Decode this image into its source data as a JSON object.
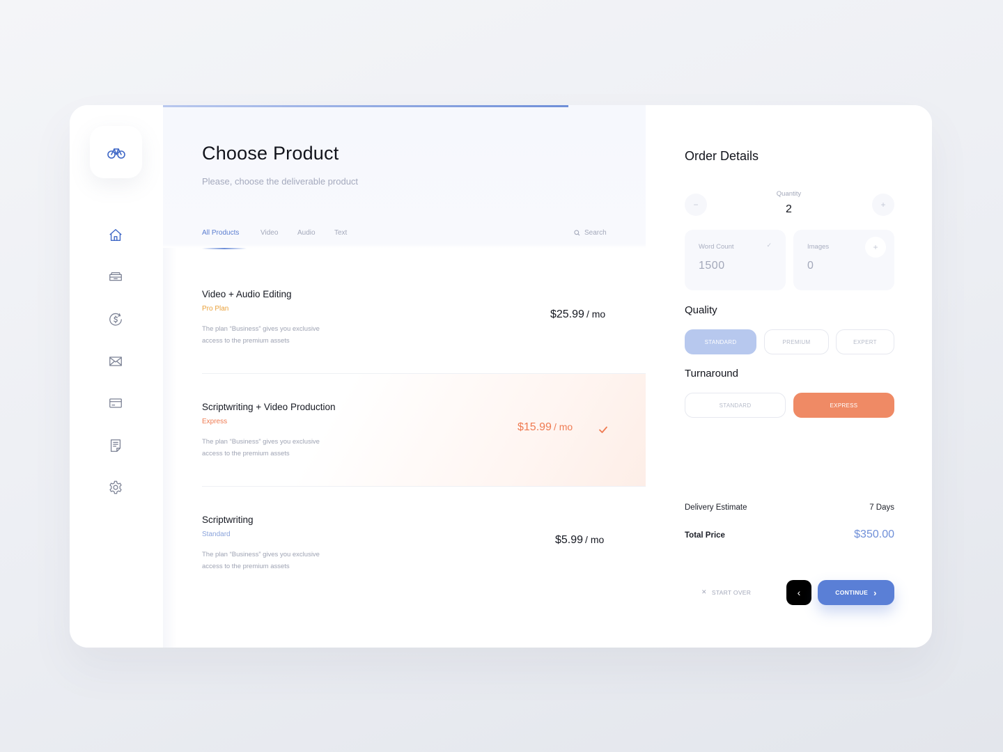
{
  "colors": {
    "accent_blue": "#5a7fd6",
    "accent_orange": "#ef8a65",
    "pro_plan": "#e9a13b",
    "express": "#ef7b52",
    "standard": "#8aa3db"
  },
  "sidebar": {
    "logo_icon": "bike-icon",
    "items": [
      {
        "icon": "home-icon"
      },
      {
        "icon": "archive-icon"
      },
      {
        "icon": "dollar-icon"
      },
      {
        "icon": "mail-icon"
      },
      {
        "icon": "credit-card-icon"
      },
      {
        "icon": "document-icon"
      },
      {
        "icon": "gear-icon"
      }
    ]
  },
  "main": {
    "progress": 0.84,
    "title": "Choose Product",
    "subtitle": "Please, choose the deliverable product",
    "tabs": [
      {
        "label": "All Products",
        "active": true
      },
      {
        "label": "Video"
      },
      {
        "label": "Audio"
      },
      {
        "label": "Text"
      }
    ],
    "search_label": "Search",
    "products": [
      {
        "name": "Video + Audio Editing",
        "plan": "Pro Plan",
        "desc_line1": "The plan “Business” gives you exclusive",
        "desc_line2": "access to the premium assets",
        "price_main": "$25",
        "price_cents": ".99",
        "price_per": "/ mo",
        "selected": false
      },
      {
        "name": "Scriptwriting + Video Production",
        "plan": "Express",
        "desc_line1": "The plan “Business” gives you exclusive",
        "desc_line2": "access to the premium assets",
        "price_main": "$15",
        "price_cents": ".99",
        "price_per": "/ mo",
        "selected": true
      },
      {
        "name": "Scriptwriting",
        "plan": "Standard",
        "desc_line1": "The plan “Business” gives you exclusive",
        "desc_line2": "access to the premium assets",
        "price_main": "$5",
        "price_cents": ".99",
        "price_per": "/ mo",
        "selected": false
      }
    ]
  },
  "order": {
    "title": "Order Details",
    "quantity_label": "Quantity",
    "quantity_value": "2",
    "minus": "−",
    "plus": "+",
    "word_count_label": "Word Count",
    "word_count_value": "1500",
    "images_label": "Images",
    "images_value": "0",
    "quality_title": "Quality",
    "quality_options": [
      "STANDARD",
      "PREMIUM",
      "EXPERT"
    ],
    "quality_selected": "STANDARD",
    "turnaround_title": "Turnaround",
    "turnaround_options": [
      "STANDARD",
      "EXPRESS"
    ],
    "turnaround_selected": "EXPRESS",
    "delivery_label": "Delivery Estimate",
    "delivery_value": "7 Days",
    "total_label": "Total Price",
    "total_main": "$350",
    "total_cents": ".00",
    "start_over_label": "START OVER",
    "back_symbol": "‹",
    "continue_label": "CONTINUE",
    "continue_symbol": "›"
  }
}
